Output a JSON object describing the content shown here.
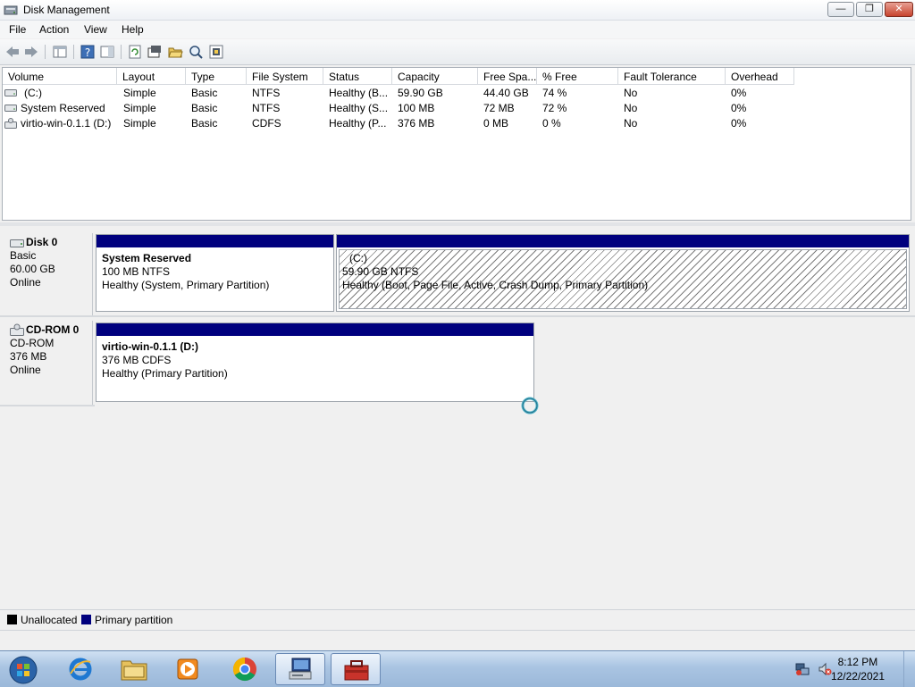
{
  "window": {
    "title": "Disk Management"
  },
  "menu": [
    "File",
    "Action",
    "View",
    "Help"
  ],
  "toolbar": {
    "buttons": [
      "back-icon",
      "forward-icon",
      "properties-panel-icon",
      "help-icon",
      "help-panel-icon",
      "refresh-icon",
      "rescan-icon",
      "open-folder-icon",
      "explore-icon",
      "settings-icon"
    ]
  },
  "volume_list": {
    "columns": [
      "Volume",
      "Layout",
      "Type",
      "File System",
      "Status",
      "Capacity",
      "Free Spa...",
      "% Free",
      "Fault Tolerance",
      "Overhead"
    ],
    "rows": [
      {
        "volume": "(C:)",
        "layout": "Simple",
        "type": "Basic",
        "fs": "NTFS",
        "status": "Healthy (B...",
        "capacity": "59.90 GB",
        "free": "44.40 GB",
        "pct_free": "74 %",
        "fault": "No",
        "overhead": "0%"
      },
      {
        "volume": "System Reserved",
        "layout": "Simple",
        "type": "Basic",
        "fs": "NTFS",
        "status": "Healthy (S...",
        "capacity": "100 MB",
        "free": "72 MB",
        "pct_free": "72 %",
        "fault": "No",
        "overhead": "0%"
      },
      {
        "volume": "virtio-win-0.1.1 (D:)",
        "layout": "Simple",
        "type": "Basic",
        "fs": "CDFS",
        "status": "Healthy (P...",
        "capacity": "376 MB",
        "free": "0 MB",
        "pct_free": "0 %",
        "fault": "No",
        "overhead": "0%"
      }
    ]
  },
  "disks": [
    {
      "name": "Disk 0",
      "type": "Basic",
      "size": "60.00 GB",
      "state": "Online",
      "partitions": [
        {
          "name": "System Reserved",
          "size": "100 MB NTFS",
          "status": "Healthy (System, Primary Partition)"
        },
        {
          "name": "(C:)",
          "size": "59.90 GB NTFS",
          "status": "Healthy (Boot, Page File, Active, Crash Dump, Primary Partition)"
        }
      ]
    },
    {
      "name": "CD-ROM 0",
      "type": "CD-ROM",
      "size": "376 MB",
      "state": "Online",
      "partitions": [
        {
          "name": "virtio-win-0.1.1  (D:)",
          "size": "376 MB CDFS",
          "status": "Healthy (Primary Partition)"
        }
      ]
    }
  ],
  "legend": {
    "unallocated": "Unallocated",
    "primary": "Primary partition",
    "colors": {
      "unallocated": "#000000",
      "primary": "#00007e"
    }
  },
  "taskbar": {
    "apps": [
      "start-orb",
      "internet-explorer-icon",
      "windows-explorer-icon",
      "media-player-icon",
      "chrome-icon",
      "disk-management-icon",
      "toolbox-icon"
    ],
    "clock": {
      "time": "8:12 PM",
      "date": "12/22/2021"
    }
  }
}
